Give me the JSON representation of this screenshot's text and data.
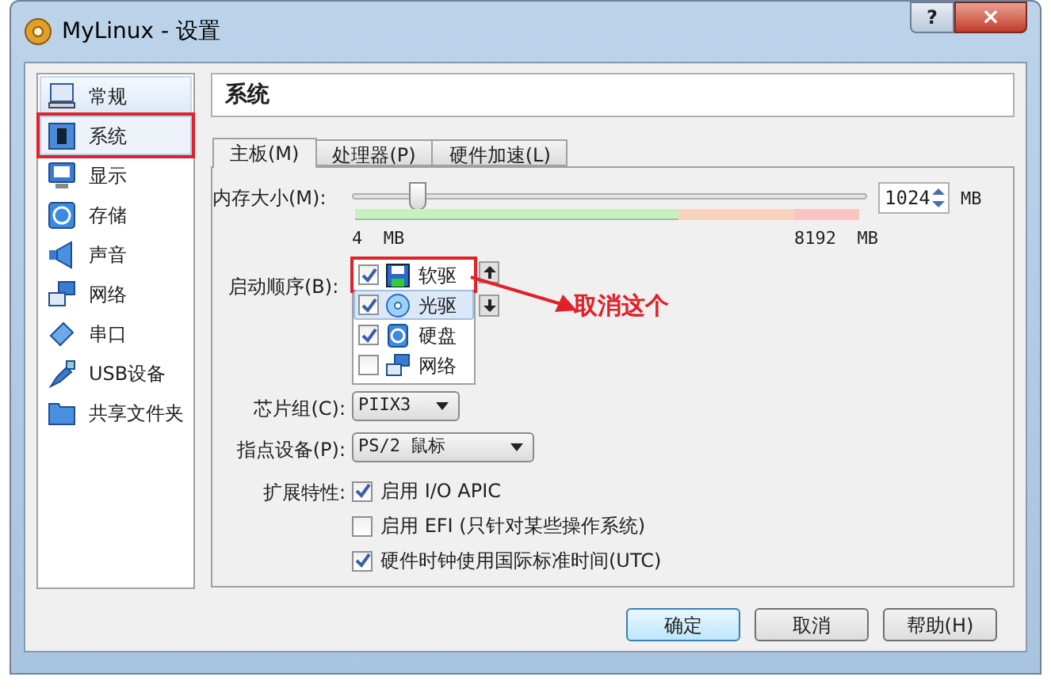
{
  "window": {
    "title": "MyLinux - 设置",
    "buttons": [
      "?",
      "×"
    ]
  },
  "sidebar": {
    "items": [
      {
        "label": "常规",
        "selected": false,
        "highlighted": true,
        "annotated": false
      },
      {
        "label": "系统",
        "selected": true,
        "highlighted": false,
        "annotated": true
      },
      {
        "label": "显示",
        "selected": false,
        "highlighted": false,
        "annotated": false
      },
      {
        "label": "存储",
        "selected": false,
        "highlighted": false,
        "annotated": false
      },
      {
        "label": "声音",
        "selected": false,
        "highlighted": false,
        "annotated": false
      },
      {
        "label": "网络",
        "selected": false,
        "highlighted": false,
        "annotated": false
      },
      {
        "label": "串口",
        "selected": false,
        "highlighted": false,
        "annotated": false
      },
      {
        "label": "USB设备",
        "selected": false,
        "highlighted": false,
        "annotated": false
      },
      {
        "label": "共享文件夹",
        "selected": false,
        "highlighted": false,
        "annotated": false
      }
    ]
  },
  "page_title": "系统",
  "tabs": [
    {
      "label": "主板(M)",
      "selected": true
    },
    {
      "label": "处理器(P)",
      "selected": false
    },
    {
      "label": "硬件加速(L)",
      "selected": false
    }
  ],
  "memory": {
    "label": "内存大小(M):",
    "level": 0.125,
    "min_label": "4  MB",
    "max_label": "8192  MB",
    "value": "1024",
    "unit": "MB"
  },
  "boot_order": {
    "label": "启动顺序(B):",
    "items": [
      {
        "label": "软驱",
        "checked": true,
        "selected": false,
        "annotated": true
      },
      {
        "label": "光驱",
        "checked": true,
        "selected": true,
        "annotated": false
      },
      {
        "label": "硬盘",
        "checked": true,
        "selected": false,
        "annotated": false
      },
      {
        "label": "网络",
        "checked": false,
        "selected": false,
        "annotated": false
      }
    ]
  },
  "annotation": {
    "text": "取消这个"
  },
  "chipset": {
    "label": "芯片组(C):",
    "value": "PIIX3"
  },
  "pointing_device": {
    "label": "指点设备(P):",
    "value": "PS/2 鼠标"
  },
  "extended_features": {
    "label": "扩展特性:",
    "items": [
      {
        "label": "启用 I/O APIC",
        "checked": true
      },
      {
        "label": "启用 EFI (只针对某些操作系统)",
        "checked": false
      },
      {
        "label": "硬件时钟使用国际标准时间(UTC)",
        "checked": true
      }
    ]
  },
  "buttons": [
    {
      "label": "确定",
      "default": true
    },
    {
      "label": "取消",
      "default": false
    },
    {
      "label": "帮助(H)",
      "default": false
    }
  ]
}
